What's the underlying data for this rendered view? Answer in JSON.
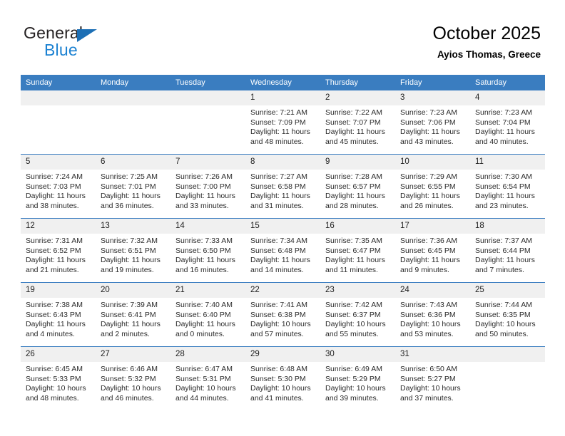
{
  "brand": {
    "name_top": "General",
    "name_bottom": "Blue",
    "triangle_color": "#1c6fb5",
    "blue_color": "#1c82d2"
  },
  "header": {
    "title": "October 2025",
    "subtitle": "Ayios Thomas, Greece"
  },
  "colors": {
    "header_row_bg": "#3a7dc0",
    "daynum_bg": "#f0f0f0",
    "page_bg": "#ffffff",
    "text": "#2b2b2b"
  },
  "weekdays": [
    "Sunday",
    "Monday",
    "Tuesday",
    "Wednesday",
    "Thursday",
    "Friday",
    "Saturday"
  ],
  "labels": {
    "sunrise_prefix": "Sunrise:",
    "sunset_prefix": "Sunset:",
    "daylight_prefix": "Daylight:"
  },
  "weeks": [
    [
      {
        "day": "",
        "empty": true
      },
      {
        "day": "",
        "empty": true
      },
      {
        "day": "",
        "empty": true
      },
      {
        "day": "1",
        "sunrise": "Sunrise: 7:21 AM",
        "sunset": "Sunset: 7:09 PM",
        "daylight_line1": "Daylight: 11 hours",
        "daylight_line2": "and 48 minutes."
      },
      {
        "day": "2",
        "sunrise": "Sunrise: 7:22 AM",
        "sunset": "Sunset: 7:07 PM",
        "daylight_line1": "Daylight: 11 hours",
        "daylight_line2": "and 45 minutes."
      },
      {
        "day": "3",
        "sunrise": "Sunrise: 7:23 AM",
        "sunset": "Sunset: 7:06 PM",
        "daylight_line1": "Daylight: 11 hours",
        "daylight_line2": "and 43 minutes."
      },
      {
        "day": "4",
        "sunrise": "Sunrise: 7:23 AM",
        "sunset": "Sunset: 7:04 PM",
        "daylight_line1": "Daylight: 11 hours",
        "daylight_line2": "and 40 minutes."
      }
    ],
    [
      {
        "day": "5",
        "sunrise": "Sunrise: 7:24 AM",
        "sunset": "Sunset: 7:03 PM",
        "daylight_line1": "Daylight: 11 hours",
        "daylight_line2": "and 38 minutes."
      },
      {
        "day": "6",
        "sunrise": "Sunrise: 7:25 AM",
        "sunset": "Sunset: 7:01 PM",
        "daylight_line1": "Daylight: 11 hours",
        "daylight_line2": "and 36 minutes."
      },
      {
        "day": "7",
        "sunrise": "Sunrise: 7:26 AM",
        "sunset": "Sunset: 7:00 PM",
        "daylight_line1": "Daylight: 11 hours",
        "daylight_line2": "and 33 minutes."
      },
      {
        "day": "8",
        "sunrise": "Sunrise: 7:27 AM",
        "sunset": "Sunset: 6:58 PM",
        "daylight_line1": "Daylight: 11 hours",
        "daylight_line2": "and 31 minutes."
      },
      {
        "day": "9",
        "sunrise": "Sunrise: 7:28 AM",
        "sunset": "Sunset: 6:57 PM",
        "daylight_line1": "Daylight: 11 hours",
        "daylight_line2": "and 28 minutes."
      },
      {
        "day": "10",
        "sunrise": "Sunrise: 7:29 AM",
        "sunset": "Sunset: 6:55 PM",
        "daylight_line1": "Daylight: 11 hours",
        "daylight_line2": "and 26 minutes."
      },
      {
        "day": "11",
        "sunrise": "Sunrise: 7:30 AM",
        "sunset": "Sunset: 6:54 PM",
        "daylight_line1": "Daylight: 11 hours",
        "daylight_line2": "and 23 minutes."
      }
    ],
    [
      {
        "day": "12",
        "sunrise": "Sunrise: 7:31 AM",
        "sunset": "Sunset: 6:52 PM",
        "daylight_line1": "Daylight: 11 hours",
        "daylight_line2": "and 21 minutes."
      },
      {
        "day": "13",
        "sunrise": "Sunrise: 7:32 AM",
        "sunset": "Sunset: 6:51 PM",
        "daylight_line1": "Daylight: 11 hours",
        "daylight_line2": "and 19 minutes."
      },
      {
        "day": "14",
        "sunrise": "Sunrise: 7:33 AM",
        "sunset": "Sunset: 6:50 PM",
        "daylight_line1": "Daylight: 11 hours",
        "daylight_line2": "and 16 minutes."
      },
      {
        "day": "15",
        "sunrise": "Sunrise: 7:34 AM",
        "sunset": "Sunset: 6:48 PM",
        "daylight_line1": "Daylight: 11 hours",
        "daylight_line2": "and 14 minutes."
      },
      {
        "day": "16",
        "sunrise": "Sunrise: 7:35 AM",
        "sunset": "Sunset: 6:47 PM",
        "daylight_line1": "Daylight: 11 hours",
        "daylight_line2": "and 11 minutes."
      },
      {
        "day": "17",
        "sunrise": "Sunrise: 7:36 AM",
        "sunset": "Sunset: 6:45 PM",
        "daylight_line1": "Daylight: 11 hours",
        "daylight_line2": "and 9 minutes."
      },
      {
        "day": "18",
        "sunrise": "Sunrise: 7:37 AM",
        "sunset": "Sunset: 6:44 PM",
        "daylight_line1": "Daylight: 11 hours",
        "daylight_line2": "and 7 minutes."
      }
    ],
    [
      {
        "day": "19",
        "sunrise": "Sunrise: 7:38 AM",
        "sunset": "Sunset: 6:43 PM",
        "daylight_line1": "Daylight: 11 hours",
        "daylight_line2": "and 4 minutes."
      },
      {
        "day": "20",
        "sunrise": "Sunrise: 7:39 AM",
        "sunset": "Sunset: 6:41 PM",
        "daylight_line1": "Daylight: 11 hours",
        "daylight_line2": "and 2 minutes."
      },
      {
        "day": "21",
        "sunrise": "Sunrise: 7:40 AM",
        "sunset": "Sunset: 6:40 PM",
        "daylight_line1": "Daylight: 11 hours",
        "daylight_line2": "and 0 minutes."
      },
      {
        "day": "22",
        "sunrise": "Sunrise: 7:41 AM",
        "sunset": "Sunset: 6:38 PM",
        "daylight_line1": "Daylight: 10 hours",
        "daylight_line2": "and 57 minutes."
      },
      {
        "day": "23",
        "sunrise": "Sunrise: 7:42 AM",
        "sunset": "Sunset: 6:37 PM",
        "daylight_line1": "Daylight: 10 hours",
        "daylight_line2": "and 55 minutes."
      },
      {
        "day": "24",
        "sunrise": "Sunrise: 7:43 AM",
        "sunset": "Sunset: 6:36 PM",
        "daylight_line1": "Daylight: 10 hours",
        "daylight_line2": "and 53 minutes."
      },
      {
        "day": "25",
        "sunrise": "Sunrise: 7:44 AM",
        "sunset": "Sunset: 6:35 PM",
        "daylight_line1": "Daylight: 10 hours",
        "daylight_line2": "and 50 minutes."
      }
    ],
    [
      {
        "day": "26",
        "sunrise": "Sunrise: 6:45 AM",
        "sunset": "Sunset: 5:33 PM",
        "daylight_line1": "Daylight: 10 hours",
        "daylight_line2": "and 48 minutes."
      },
      {
        "day": "27",
        "sunrise": "Sunrise: 6:46 AM",
        "sunset": "Sunset: 5:32 PM",
        "daylight_line1": "Daylight: 10 hours",
        "daylight_line2": "and 46 minutes."
      },
      {
        "day": "28",
        "sunrise": "Sunrise: 6:47 AM",
        "sunset": "Sunset: 5:31 PM",
        "daylight_line1": "Daylight: 10 hours",
        "daylight_line2": "and 44 minutes."
      },
      {
        "day": "29",
        "sunrise": "Sunrise: 6:48 AM",
        "sunset": "Sunset: 5:30 PM",
        "daylight_line1": "Daylight: 10 hours",
        "daylight_line2": "and 41 minutes."
      },
      {
        "day": "30",
        "sunrise": "Sunrise: 6:49 AM",
        "sunset": "Sunset: 5:29 PM",
        "daylight_line1": "Daylight: 10 hours",
        "daylight_line2": "and 39 minutes."
      },
      {
        "day": "31",
        "sunrise": "Sunrise: 6:50 AM",
        "sunset": "Sunset: 5:27 PM",
        "daylight_line1": "Daylight: 10 hours",
        "daylight_line2": "and 37 minutes."
      },
      {
        "day": "",
        "empty": true
      }
    ]
  ]
}
